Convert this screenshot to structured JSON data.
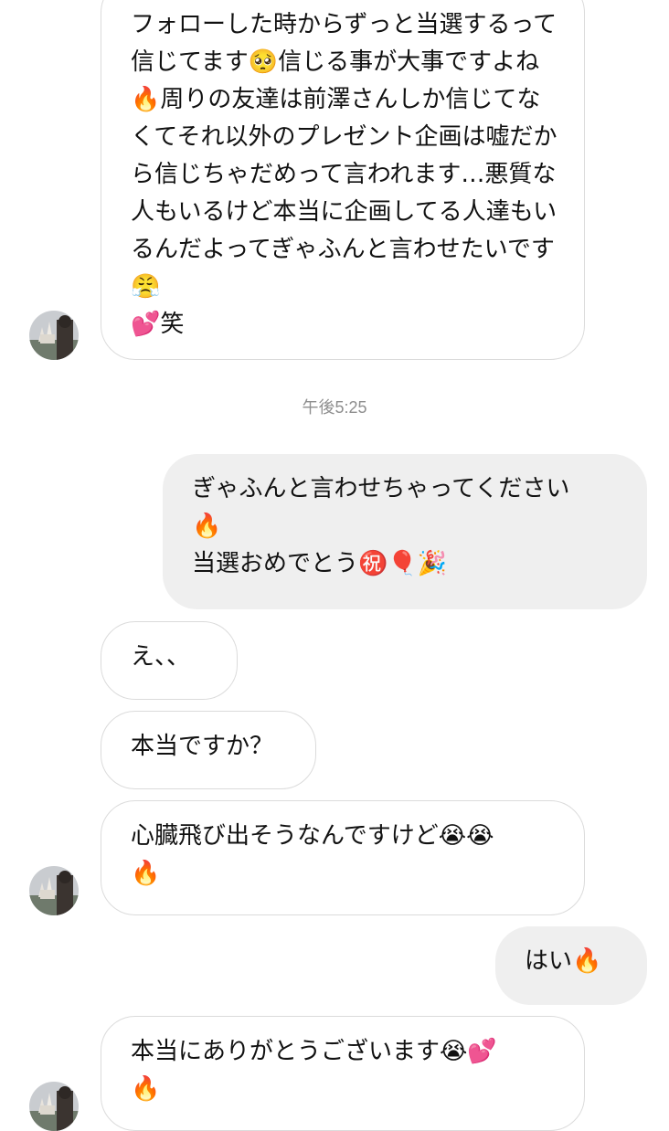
{
  "thread": {
    "timestamp": "午後5:25",
    "messages": [
      {
        "sender": "other",
        "text": "フォローした時からずっと当選するって信じてます🥺信じる事が大事ですよね🔥周りの友達は前澤さんしか信じてなくてそれ以外のプレゼント企画は嘘だから信じちゃだめって言われます…悪質な人もいるけど本当に企画してる人達もいるんだよってぎゃふんと言わせたいです😤\n💕笑"
      },
      {
        "sender": "me",
        "text": "ぎゃふんと言わせちゃってください\n🔥\n当選おめでとう㊗️🎈🎉"
      },
      {
        "sender": "other",
        "text": "え、、"
      },
      {
        "sender": "other",
        "text": "本当ですか？"
      },
      {
        "sender": "other",
        "text": "心臓飛び出そうなんですけど😭😭\n🔥"
      },
      {
        "sender": "me",
        "text": "はい🔥"
      },
      {
        "sender": "other",
        "text": "本当にありがとうございます😭💕\n🔥"
      }
    ]
  },
  "colors": {
    "incoming_border": "#dbdbdb",
    "outgoing_background": "#efefef",
    "timestamp": "#8e8e8e"
  }
}
